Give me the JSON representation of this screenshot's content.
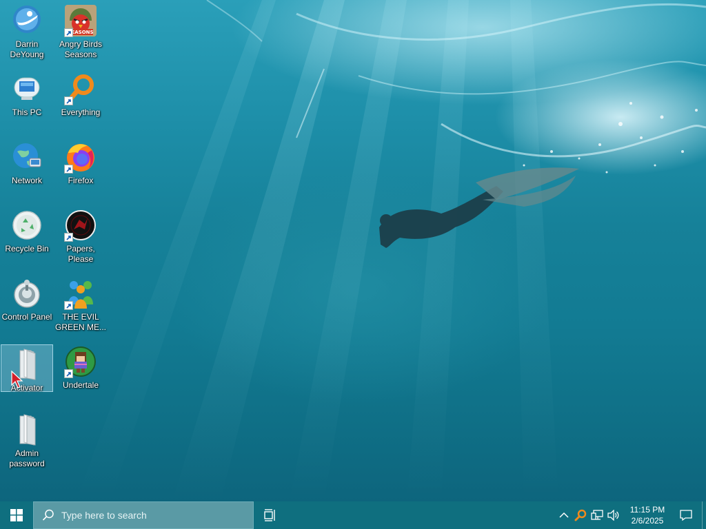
{
  "desktop": {
    "icons": [
      {
        "label": "Darrin DeYoung",
        "icon": "user-folder-icon",
        "shortcut": false
      },
      {
        "label": "This PC",
        "icon": "computer-icon",
        "shortcut": false
      },
      {
        "label": "Network",
        "icon": "network-globe-icon",
        "shortcut": false
      },
      {
        "label": "Recycle Bin",
        "icon": "recycle-bin-icon",
        "shortcut": false
      },
      {
        "label": "Control Panel",
        "icon": "control-panel-icon",
        "shortcut": false
      },
      {
        "label": "Activator",
        "icon": "folder-icon",
        "shortcut": false,
        "selected": true
      },
      {
        "label": "Admin password",
        "icon": "folder-icon",
        "shortcut": false
      },
      {
        "label": "Angry Birds Seasons",
        "icon": "angry-birds-icon",
        "shortcut": true
      },
      {
        "label": "Everything",
        "icon": "magnifier-search-icon",
        "shortcut": true
      },
      {
        "label": "Firefox",
        "icon": "firefox-icon",
        "shortcut": true
      },
      {
        "label": "Papers, Please",
        "icon": "papers-please-icon",
        "shortcut": true
      },
      {
        "label": "THE EVIL GREEN ME...",
        "icon": "messenger-people-icon",
        "shortcut": true
      },
      {
        "label": "Undertale",
        "icon": "undertale-icon",
        "shortcut": true
      }
    ],
    "angry_birds_badge": "SEASONS"
  },
  "taskbar": {
    "search_placeholder": "Type here to search",
    "clock_time": "11:15 PM",
    "clock_date": "2/6/2025"
  },
  "colors": {
    "taskbar": "#0f6f7f",
    "search_box": "#5a9aa5",
    "accent_orange": "#f08a1c"
  }
}
